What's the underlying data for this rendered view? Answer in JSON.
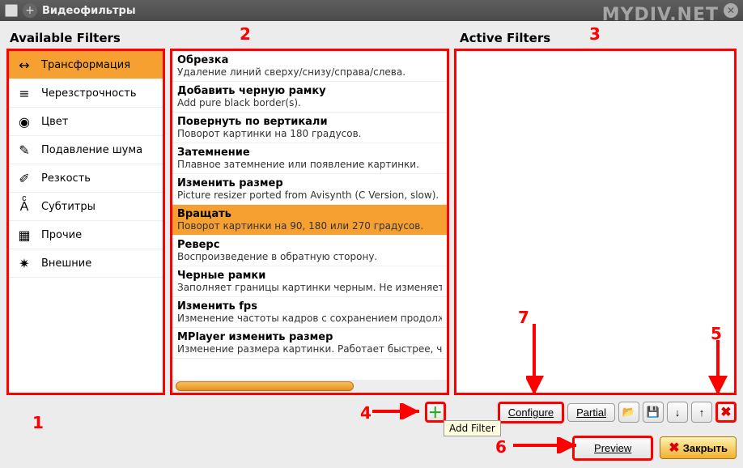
{
  "window": {
    "title": "Видеофильтры"
  },
  "watermark": "MYDIV.NET",
  "headers": {
    "available": "Available Filters",
    "active": "Active Filters"
  },
  "categories": [
    {
      "key": "transform",
      "label": "Трансформация",
      "icon": "↔",
      "selected": true
    },
    {
      "key": "interlace",
      "label": "Черезстрочность",
      "icon": "≡",
      "selected": false
    },
    {
      "key": "color",
      "label": "Цвет",
      "icon": "◉",
      "selected": false
    },
    {
      "key": "denoise",
      "label": "Подавление шума",
      "icon": "✎",
      "selected": false
    },
    {
      "key": "sharp",
      "label": "Резкость",
      "icon": "✐",
      "selected": false
    },
    {
      "key": "subs",
      "label": "Субтитры",
      "icon": "Aͨ",
      "selected": false
    },
    {
      "key": "other",
      "label": "Прочие",
      "icon": "▦",
      "selected": false
    },
    {
      "key": "external",
      "label": "Внешние",
      "icon": "✷",
      "selected": false
    }
  ],
  "filters": [
    {
      "title": "Обрезка",
      "desc": "Удаление линий сверху/снизу/справа/слева.",
      "selected": false
    },
    {
      "title": "Добавить черную рамку",
      "desc": "Add pure black border(s).",
      "selected": false
    },
    {
      "title": "Повернуть по вертикали",
      "desc": "Поворот картинки на 180 градусов.",
      "selected": false
    },
    {
      "title": "Затемнение",
      "desc": "Плавное затемнение или появление картинки.",
      "selected": false
    },
    {
      "title": "Изменить размер",
      "desc": "Picture resizer ported from Avisynth (C Version, slow).",
      "selected": false
    },
    {
      "title": "Вращать",
      "desc": "Поворот картинки на 90, 180 или 270 градусов.",
      "selected": true
    },
    {
      "title": "Реверс",
      "desc": "Воспроизведение в обратную сторону.",
      "selected": false
    },
    {
      "title": "Черные рамки",
      "desc": "Заполняет границы картинки черным. Не изменяет её размер.",
      "selected": false
    },
    {
      "title": "Изменить fps",
      "desc": "Изменение частоты кадров с сохранением продолжительности.",
      "selected": false
    },
    {
      "title": "MPlayer изменить размер",
      "desc": "Изменение размера картинки. Работает быстрее, чем Avisynth-ова",
      "selected": false
    }
  ],
  "buttons": {
    "configure": "Configure",
    "partial": "Partial",
    "preview": "Preview",
    "close": "Закрыть",
    "add_tooltip": "Add Filter"
  },
  "annotations": {
    "n1": "1",
    "n2": "2",
    "n3": "3",
    "n4": "4",
    "n5": "5",
    "n6": "6",
    "n7": "7"
  }
}
